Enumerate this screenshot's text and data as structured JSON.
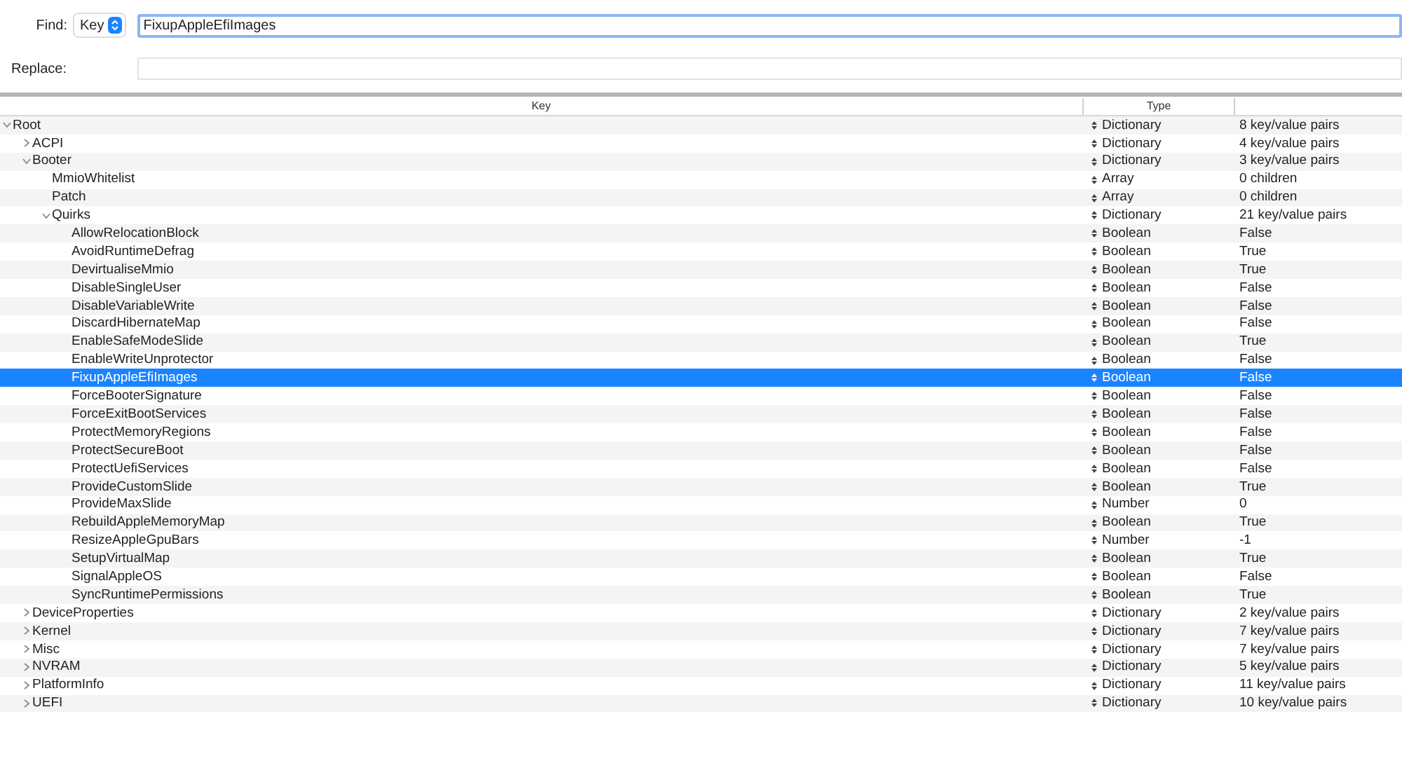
{
  "find": {
    "label": "Find:",
    "mode": "Key",
    "value": "FixupAppleEfiImages"
  },
  "replace": {
    "label": "Replace:"
  },
  "table": {
    "columns": [
      "Key",
      "Type"
    ],
    "root": {
      "key": "Root",
      "type": "Dictionary",
      "value": "8 key/value pairs",
      "selected": false,
      "expanded": true,
      "children": [
        {
          "key": "ACPI",
          "type": "Dictionary",
          "value": "4 key/value pairs",
          "selected": false,
          "expanded": false
        },
        {
          "key": "Booter",
          "type": "Dictionary",
          "value": "3 key/value pairs",
          "selected": false,
          "expanded": true,
          "children": [
            {
              "key": "MmioWhitelist",
              "type": "Array",
              "value": "0 children",
              "selected": false
            },
            {
              "key": "Patch",
              "type": "Array",
              "value": "0 children",
              "selected": false
            },
            {
              "key": "Quirks",
              "type": "Dictionary",
              "value": "21 key/value pairs",
              "selected": false,
              "expanded": true,
              "children": [
                {
                  "key": "AllowRelocationBlock",
                  "type": "Boolean",
                  "value": "False",
                  "selected": false
                },
                {
                  "key": "AvoidRuntimeDefrag",
                  "type": "Boolean",
                  "value": "True",
                  "selected": false
                },
                {
                  "key": "DevirtualiseMmio",
                  "type": "Boolean",
                  "value": "True",
                  "selected": false
                },
                {
                  "key": "DisableSingleUser",
                  "type": "Boolean",
                  "value": "False",
                  "selected": false
                },
                {
                  "key": "DisableVariableWrite",
                  "type": "Boolean",
                  "value": "False",
                  "selected": false
                },
                {
                  "key": "DiscardHibernateMap",
                  "type": "Boolean",
                  "value": "False",
                  "selected": false
                },
                {
                  "key": "EnableSafeModeSlide",
                  "type": "Boolean",
                  "value": "True",
                  "selected": false
                },
                {
                  "key": "EnableWriteUnprotector",
                  "type": "Boolean",
                  "value": "False",
                  "selected": false
                },
                {
                  "key": "FixupAppleEfiImages",
                  "type": "Boolean",
                  "value": "False",
                  "selected": true
                },
                {
                  "key": "ForceBooterSignature",
                  "type": "Boolean",
                  "value": "False",
                  "selected": false
                },
                {
                  "key": "ForceExitBootServices",
                  "type": "Boolean",
                  "value": "False",
                  "selected": false
                },
                {
                  "key": "ProtectMemoryRegions",
                  "type": "Boolean",
                  "value": "False",
                  "selected": false
                },
                {
                  "key": "ProtectSecureBoot",
                  "type": "Boolean",
                  "value": "False",
                  "selected": false
                },
                {
                  "key": "ProtectUefiServices",
                  "type": "Boolean",
                  "value": "False",
                  "selected": false
                },
                {
                  "key": "ProvideCustomSlide",
                  "type": "Boolean",
                  "value": "True",
                  "selected": false
                },
                {
                  "key": "ProvideMaxSlide",
                  "type": "Number",
                  "value": "0",
                  "selected": false
                },
                {
                  "key": "RebuildAppleMemoryMap",
                  "type": "Boolean",
                  "value": "True",
                  "selected": false
                },
                {
                  "key": "ResizeAppleGpuBars",
                  "type": "Number",
                  "value": "-1",
                  "selected": false
                },
                {
                  "key": "SetupVirtualMap",
                  "type": "Boolean",
                  "value": "True",
                  "selected": false
                },
                {
                  "key": "SignalAppleOS",
                  "type": "Boolean",
                  "value": "False",
                  "selected": false
                },
                {
                  "key": "SyncRuntimePermissions",
                  "type": "Boolean",
                  "value": "True",
                  "selected": false
                }
              ]
            }
          ]
        },
        {
          "key": "DeviceProperties",
          "type": "Dictionary",
          "value": "2 key/value pairs",
          "selected": false,
          "expanded": false
        },
        {
          "key": "Kernel",
          "type": "Dictionary",
          "value": "7 key/value pairs",
          "selected": false,
          "expanded": false
        },
        {
          "key": "Misc",
          "type": "Dictionary",
          "value": "7 key/value pairs",
          "selected": false,
          "expanded": false
        },
        {
          "key": "NVRAM",
          "type": "Dictionary",
          "value": "5 key/value pairs",
          "selected": false,
          "expanded": false
        },
        {
          "key": "PlatformInfo",
          "type": "Dictionary",
          "value": "11 key/value pairs",
          "selected": false,
          "expanded": false
        },
        {
          "key": "UEFI",
          "type": "Dictionary",
          "value": "10 key/value pairs",
          "selected": false,
          "expanded": false
        }
      ]
    }
  }
}
